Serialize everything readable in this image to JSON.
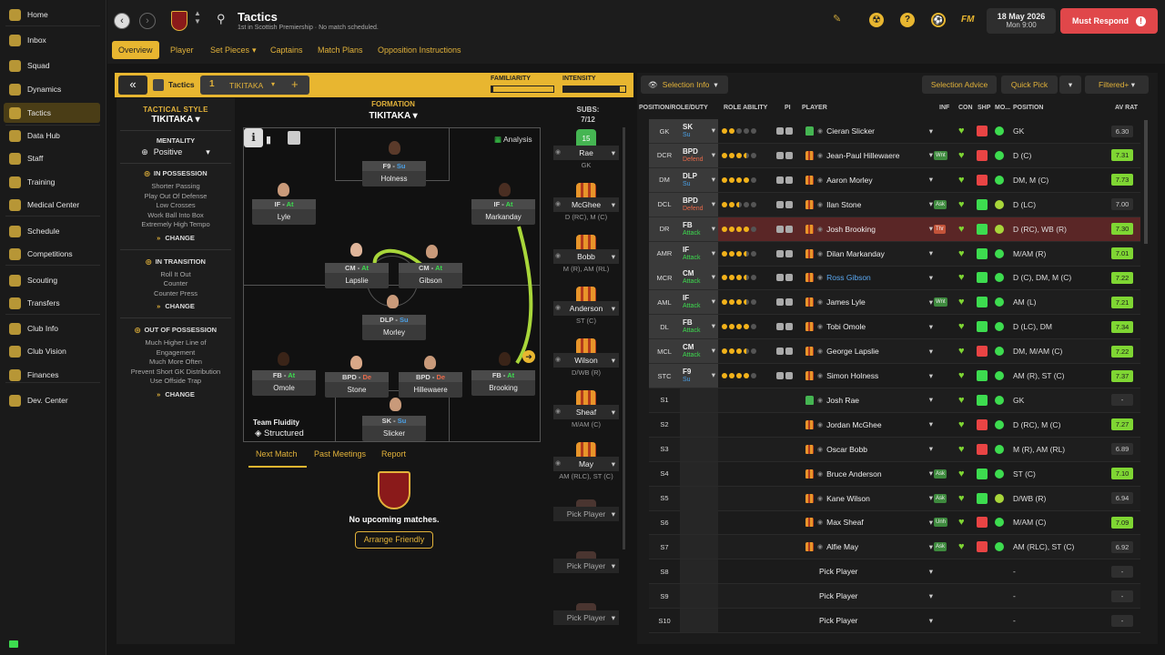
{
  "sidebar": {
    "items": [
      {
        "label": "Home",
        "icon": "home-icon"
      },
      {
        "label": "Inbox",
        "icon": "inbox-icon"
      },
      {
        "label": "Squad",
        "icon": "shirt-icon"
      },
      {
        "label": "Dynamics",
        "icon": "dynamics-icon"
      },
      {
        "label": "Tactics",
        "icon": "tactics-icon"
      },
      {
        "label": "Data Hub",
        "icon": "data-hub-icon"
      },
      {
        "label": "Staff",
        "icon": "staff-icon"
      },
      {
        "label": "Training",
        "icon": "training-icon"
      },
      {
        "label": "Medical Center",
        "icon": "medical-icon"
      },
      {
        "label": "Schedule",
        "icon": "calendar-icon"
      },
      {
        "label": "Competitions",
        "icon": "trophy-icon"
      },
      {
        "label": "Scouting",
        "icon": "scouting-icon"
      },
      {
        "label": "Transfers",
        "icon": "transfers-icon"
      },
      {
        "label": "Club Info",
        "icon": "club-info-icon"
      },
      {
        "label": "Club Vision",
        "icon": "club-vision-icon"
      },
      {
        "label": "Finances",
        "icon": "finances-icon"
      },
      {
        "label": "Dev. Center",
        "icon": "dev-center-icon"
      }
    ],
    "active": "Tactics"
  },
  "header": {
    "title": "Tactics",
    "subtitle": "1st in Scottish Premiership · No match scheduled.",
    "date": "18 May 2026",
    "time": "Mon 9:00",
    "must_respond": "Must Respond",
    "fm": "FM"
  },
  "subnav": {
    "tabs": [
      "Overview",
      "Player",
      "Set Pieces",
      "Captains",
      "Match Plans",
      "Opposition Instructions"
    ],
    "active": "Overview"
  },
  "tacbar": {
    "tactics_label": "Tactics",
    "tactic_name": "TIKITAKA",
    "tactic_slot": "1",
    "familiarity": "FAMILIARITY",
    "intensity": "INTENSITY"
  },
  "style": {
    "title": "TACTICAL STYLE",
    "name": "TIKITAKA",
    "mentality_label": "MENTALITY",
    "mentality": "Positive",
    "possession_title": "IN POSSESSION",
    "possession": [
      "Shorter Passing",
      "Play Out Of Defense",
      "Low Crosses",
      "Work Ball Into Box",
      "Extremely High Tempo"
    ],
    "transition_title": "IN TRANSITION",
    "transition": [
      "Roll It Out",
      "Counter",
      "Counter Press"
    ],
    "oop_title": "OUT OF POSSESSION",
    "oop": [
      "Much Higher Line of",
      "Engagement",
      "Much More Often",
      "Prevent Short GK Distribution",
      "Use Offside Trap"
    ],
    "change": "CHANGE"
  },
  "formation": {
    "label": "FORMATION",
    "name": "TIKITAKA",
    "analysis": "Analysis",
    "fluidity_label": "Team Fluidity",
    "fluidity": "Structured",
    "cards": [
      {
        "role": "F9",
        "duty": "Su",
        "name": "Holness"
      },
      {
        "role": "IF",
        "duty": "At",
        "name": "Lyle"
      },
      {
        "role": "IF",
        "duty": "At",
        "name": "Markanday"
      },
      {
        "role": "CM",
        "duty": "At",
        "name": "Lapslie"
      },
      {
        "role": "CM",
        "duty": "At",
        "name": "Gibson"
      },
      {
        "role": "DLP",
        "duty": "Su",
        "name": "Morley"
      },
      {
        "role": "FB",
        "duty": "At",
        "name": "Omole"
      },
      {
        "role": "BPD",
        "duty": "De",
        "name": "Stone"
      },
      {
        "role": "BPD",
        "duty": "De",
        "name": "Hillewaere"
      },
      {
        "role": "FB",
        "duty": "At",
        "name": "Brooking"
      },
      {
        "role": "SK",
        "duty": "Su",
        "name": "Slicker"
      }
    ]
  },
  "match": {
    "tabs": [
      "Next Match",
      "Past Meetings",
      "Report"
    ],
    "no_matches": "No upcoming matches.",
    "arrange": "Arrange Friendly"
  },
  "subs": {
    "label": "SUBS:",
    "count": "7/12",
    "gk_num": "15",
    "list": [
      {
        "name": "Rae",
        "pos": "GK",
        "gk": true
      },
      {
        "name": "McGhee",
        "pos": "D (RC), M (C)"
      },
      {
        "name": "Bobb",
        "pos": "M (R), AM (RL)"
      },
      {
        "name": "Anderson",
        "pos": "ST (C)"
      },
      {
        "name": "Wilson",
        "pos": "D/WB (R)"
      },
      {
        "name": "Sheaf",
        "pos": "M/AM (C)"
      },
      {
        "name": "May",
        "pos": "AM (RLC), ST (C)"
      },
      {
        "name": "Pick Player",
        "pos": "",
        "empty": true
      },
      {
        "name": "Pick Player",
        "pos": "",
        "empty": true
      },
      {
        "name": "Pick Player",
        "pos": "",
        "empty": true
      }
    ]
  },
  "right": {
    "selection_info": "Selection Info",
    "selection_advice": "Selection Advice",
    "quick_pick": "Quick Pick",
    "filtered": "Filtered+",
    "headers": {
      "prd": "POSITION/ROLE/DUTY",
      "ra": "ROLE ABILITY",
      "pi": "PI",
      "player": "PLAYER",
      "inf": "INF",
      "con": "CON",
      "shp": "SHP",
      "mo": "MO...",
      "position": "POSITION",
      "avrat": "AV RAT"
    },
    "rows": [
      {
        "pos": "GK",
        "role": "SK",
        "duty": "Su",
        "stars": [
          1,
          1,
          0,
          0,
          0
        ],
        "player": "Cieran Slicker",
        "gk": true,
        "inf": "",
        "position": "GK",
        "rating": "6.30",
        "green": false
      },
      {
        "pos": "DCR",
        "role": "BPD",
        "duty": "Defend",
        "stars": [
          1,
          1,
          1,
          2,
          0
        ],
        "player": "Jean-Paul Hillewaere",
        "inf": "Wnt",
        "position": "D (C)",
        "rating": "7.31",
        "green": true
      },
      {
        "pos": "DM",
        "role": "DLP",
        "duty": "Su",
        "stars": [
          1,
          1,
          1,
          1,
          0
        ],
        "player": "Aaron Morley",
        "inf": "",
        "position": "DM, M (C)",
        "rating": "7.73",
        "green": true
      },
      {
        "pos": "DCL",
        "role": "BPD",
        "duty": "Defend",
        "stars": [
          1,
          1,
          2,
          0,
          0
        ],
        "player": "Ilan Stone",
        "inf": "Ask",
        "position": "D (LC)",
        "rating": "7.00",
        "green": false
      },
      {
        "pos": "DR",
        "role": "FB",
        "duty": "Attack",
        "stars": [
          1,
          1,
          1,
          1,
          0
        ],
        "player": "Josh Brooking",
        "inf": "Thr",
        "position": "D (RC), WB (R)",
        "rating": "7.30",
        "green": true,
        "sel": true
      },
      {
        "pos": "AMR",
        "role": "IF",
        "duty": "Attack",
        "stars": [
          1,
          1,
          1,
          2,
          0
        ],
        "player": "Dilan Markanday",
        "inf": "",
        "position": "M/AM (R)",
        "rating": "7.01",
        "green": true
      },
      {
        "pos": "MCR",
        "role": "CM",
        "duty": "Attack",
        "stars": [
          1,
          1,
          1,
          2,
          0
        ],
        "player": "Ross Gibson",
        "inf": "",
        "position": "D (C), DM, M (C)",
        "rating": "7.22",
        "green": true,
        "blue": true
      },
      {
        "pos": "AML",
        "role": "IF",
        "duty": "Attack",
        "stars": [
          1,
          1,
          1,
          2,
          0
        ],
        "player": "James Lyle",
        "inf": "Wnt",
        "position": "AM (L)",
        "rating": "7.21",
        "green": true
      },
      {
        "pos": "DL",
        "role": "FB",
        "duty": "Attack",
        "stars": [
          1,
          1,
          1,
          1,
          0
        ],
        "player": "Tobi Omole",
        "inf": "",
        "position": "D (LC), DM",
        "rating": "7.34",
        "green": true
      },
      {
        "pos": "MCL",
        "role": "CM",
        "duty": "Attack",
        "stars": [
          1,
          1,
          1,
          2,
          0
        ],
        "player": "George Lapslie",
        "inf": "",
        "position": "DM, M/AM (C)",
        "rating": "7.22",
        "green": true
      },
      {
        "pos": "STC",
        "role": "F9",
        "duty": "Su",
        "stars": [
          1,
          1,
          1,
          1,
          0
        ],
        "player": "Simon Holness",
        "inf": "",
        "position": "AM (R), ST (C)",
        "rating": "7.37",
        "green": true
      },
      {
        "pos": "S1",
        "role": "",
        "duty": "",
        "stars": [],
        "player": "Josh Rae",
        "gk": true,
        "inf": "",
        "position": "GK",
        "rating": "-",
        "green": false
      },
      {
        "pos": "S2",
        "role": "",
        "duty": "",
        "stars": [],
        "player": "Jordan McGhee",
        "inf": "",
        "position": "D (RC), M (C)",
        "rating": "7.27",
        "green": true
      },
      {
        "pos": "S3",
        "role": "",
        "duty": "",
        "stars": [],
        "player": "Oscar Bobb",
        "inf": "",
        "position": "M (R), AM (RL)",
        "rating": "6.89",
        "green": false
      },
      {
        "pos": "S4",
        "role": "",
        "duty": "",
        "stars": [],
        "player": "Bruce Anderson",
        "inf": "Ask",
        "position": "ST (C)",
        "rating": "7.10",
        "green": true
      },
      {
        "pos": "S5",
        "role": "",
        "duty": "",
        "stars": [],
        "player": "Kane Wilson",
        "inf": "Ask",
        "position": "D/WB (R)",
        "rating": "6.94",
        "green": false
      },
      {
        "pos": "S6",
        "role": "",
        "duty": "",
        "stars": [],
        "player": "Max Sheaf",
        "inf": "Unh",
        "position": "M/AM (C)",
        "rating": "7.09",
        "green": true
      },
      {
        "pos": "S7",
        "role": "",
        "duty": "",
        "stars": [],
        "player": "Alfie May",
        "inf": "Ask",
        "position": "AM (RLC), ST (C)",
        "rating": "6.92",
        "green": false
      },
      {
        "pos": "S8",
        "role": "",
        "duty": "",
        "stars": [],
        "player": "Pick Player",
        "empty": true,
        "inf": "",
        "position": "-",
        "rating": "-",
        "green": false
      },
      {
        "pos": "S9",
        "role": "",
        "duty": "",
        "stars": [],
        "player": "Pick Player",
        "empty": true,
        "inf": "",
        "position": "-",
        "rating": "-",
        "green": false
      },
      {
        "pos": "S10",
        "role": "",
        "duty": "",
        "stars": [],
        "player": "Pick Player",
        "empty": true,
        "inf": "",
        "position": "-",
        "rating": "-",
        "green": false
      }
    ]
  },
  "colors": {
    "accent": "#e8b630",
    "must_respond": "#e0474a",
    "green_rating": "#7fd633",
    "selected_row": "#5a2626"
  }
}
